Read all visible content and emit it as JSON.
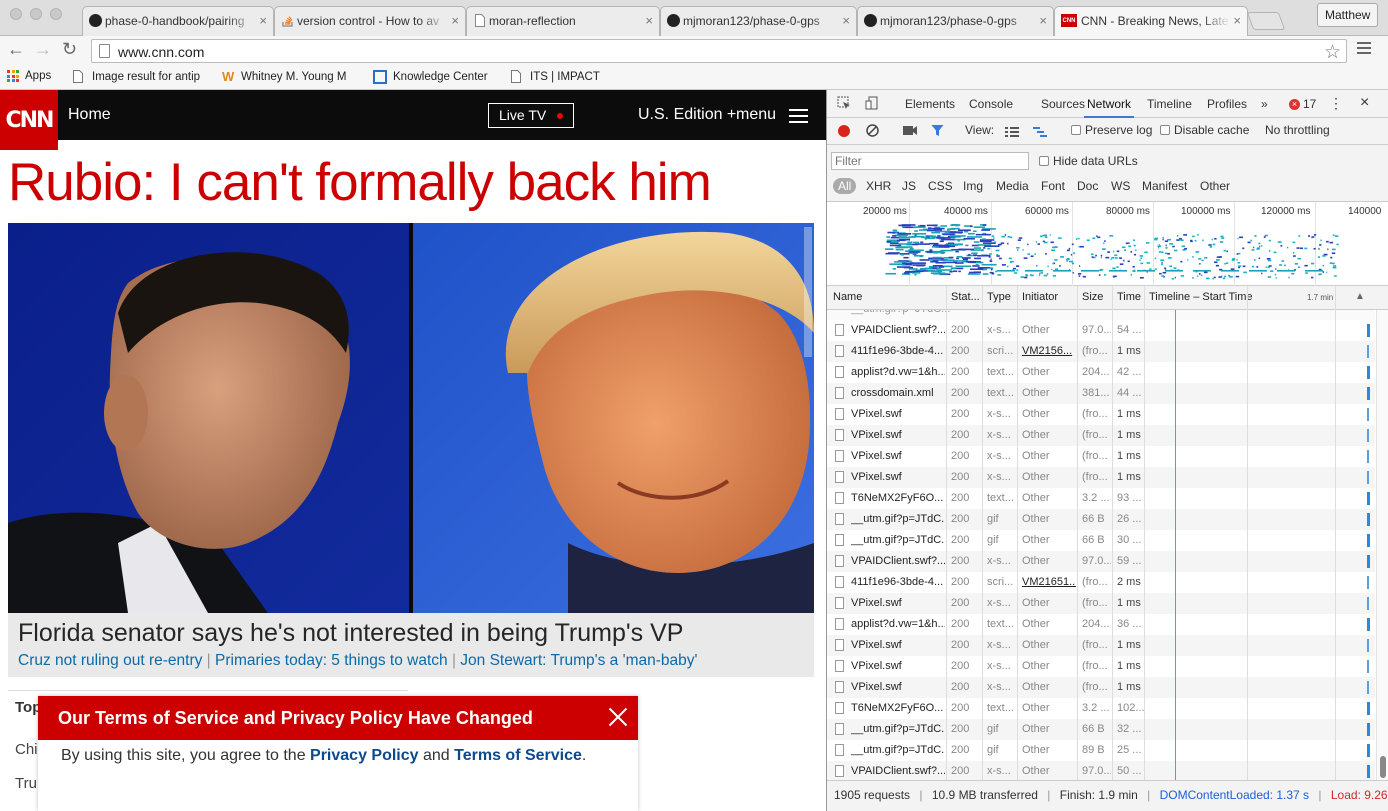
{
  "browser": {
    "tabs": [
      {
        "title": "phase-0-handbook/pairing",
        "icon": "github-icon"
      },
      {
        "title": "version control - How to av",
        "icon": "stackoverflow-icon"
      },
      {
        "title": "moran-reflection",
        "icon": "page-icon"
      },
      {
        "title": "mjmoran123/phase-0-gps",
        "icon": "github-icon"
      },
      {
        "title": "mjmoran123/phase-0-gps",
        "icon": "github-icon"
      },
      {
        "title": "CNN - Breaking News, Late",
        "icon": "cnn-icon"
      }
    ],
    "profile_name": "Matthew",
    "url": "www.cnn.com",
    "bookmarks": [
      "Apps",
      "Image result for antip",
      "Whitney M. Young M",
      "Knowledge Center",
      "ITS | IMPACT"
    ]
  },
  "cnn": {
    "logo_text": "CNN",
    "home_link": "Home",
    "live_tv": "Live TV",
    "edition": "U.S. Edition +",
    "menu": "menu",
    "headline": "Rubio: I can't formally back him",
    "subheadline": "Florida senator says he's not interested in being Trump's VP",
    "related": [
      "Cruz not ruling out re-entry",
      "Primaries today: 5 things to watch",
      "Jon Stewart: Trump's a 'man-baby'"
    ],
    "related_sep": "|",
    "top_section_label": "Top",
    "list_stubs": [
      "Chin",
      "Trum"
    ],
    "tos_title": "Our Terms of Service and Privacy Policy Have Changed",
    "tos_body_1": "By using this site, you agree to the ",
    "tos_privacy_link": "Privacy Policy",
    "tos_and": " and ",
    "tos_terms_link": "Terms of Service",
    "tos_period": "."
  },
  "devtools": {
    "tabs": [
      "Elements",
      "Console",
      "Sources",
      "Network",
      "Timeline",
      "Profiles"
    ],
    "active_tab": "Network",
    "more": "»",
    "error_count": "17",
    "view_label": "View:",
    "preserve_log": "Preserve log",
    "disable_cache": "Disable cache",
    "throttling": "No throttling",
    "filter_placeholder": "Filter",
    "hide_data_urls": "Hide data URLs",
    "type_filters": [
      "All",
      "XHR",
      "JS",
      "CSS",
      "Img",
      "Media",
      "Font",
      "Doc",
      "WS",
      "Manifest",
      "Other"
    ],
    "overview_ticks": [
      "20000 ms",
      "40000 ms",
      "60000 ms",
      "80000 ms",
      "100000 ms",
      "120000 ms",
      "140000"
    ],
    "columns": [
      "Name",
      "Stat...",
      "Type",
      "Initiator",
      "Size",
      "Time",
      "Timeline – Start Time"
    ],
    "timeline_scale": "1.7 min",
    "rows": [
      {
        "name": "VPAIDClient.swf?...",
        "status": "200",
        "type": "x-s...",
        "initiator": "Other",
        "size": "97.0...",
        "time": "54 ..."
      },
      {
        "name": "411f1e96-3bde-4...",
        "status": "200",
        "type": "scri...",
        "initiator": "VM2156...",
        "size": "(fro...",
        "time": "1 ms"
      },
      {
        "name": "applist?d.vw=1&h...",
        "status": "200",
        "type": "text...",
        "initiator": "Other",
        "size": "204...",
        "time": "42 ..."
      },
      {
        "name": "crossdomain.xml",
        "status": "200",
        "type": "text...",
        "initiator": "Other",
        "size": "381...",
        "time": "44 ..."
      },
      {
        "name": "VPixel.swf",
        "status": "200",
        "type": "x-s...",
        "initiator": "Other",
        "size": "(fro...",
        "time": "1 ms"
      },
      {
        "name": "VPixel.swf",
        "status": "200",
        "type": "x-s...",
        "initiator": "Other",
        "size": "(fro...",
        "time": "1 ms"
      },
      {
        "name": "VPixel.swf",
        "status": "200",
        "type": "x-s...",
        "initiator": "Other",
        "size": "(fro...",
        "time": "1 ms"
      },
      {
        "name": "VPixel.swf",
        "status": "200",
        "type": "x-s...",
        "initiator": "Other",
        "size": "(fro...",
        "time": "1 ms"
      },
      {
        "name": "T6NeMX2FyF6O...",
        "status": "200",
        "type": "text...",
        "initiator": "Other",
        "size": "3.2 ...",
        "time": "93 ..."
      },
      {
        "name": "__utm.gif?p=JTdC...",
        "status": "200",
        "type": "gif",
        "initiator": "Other",
        "size": "66 B",
        "time": "26 ..."
      },
      {
        "name": "__utm.gif?p=JTdC...",
        "status": "200",
        "type": "gif",
        "initiator": "Other",
        "size": "66 B",
        "time": "30 ..."
      },
      {
        "name": "VPAIDClient.swf?...",
        "status": "200",
        "type": "x-s...",
        "initiator": "Other",
        "size": "97.0...",
        "time": "59 ..."
      },
      {
        "name": "411f1e96-3bde-4...",
        "status": "200",
        "type": "scri...",
        "initiator": "VM21651...",
        "size": "(fro...",
        "time": "2 ms"
      },
      {
        "name": "VPixel.swf",
        "status": "200",
        "type": "x-s...",
        "initiator": "Other",
        "size": "(fro...",
        "time": "1 ms"
      },
      {
        "name": "applist?d.vw=1&h...",
        "status": "200",
        "type": "text...",
        "initiator": "Other",
        "size": "204...",
        "time": "36 ..."
      },
      {
        "name": "VPixel.swf",
        "status": "200",
        "type": "x-s...",
        "initiator": "Other",
        "size": "(fro...",
        "time": "1 ms"
      },
      {
        "name": "VPixel.swf",
        "status": "200",
        "type": "x-s...",
        "initiator": "Other",
        "size": "(fro...",
        "time": "1 ms"
      },
      {
        "name": "VPixel.swf",
        "status": "200",
        "type": "x-s...",
        "initiator": "Other",
        "size": "(fro...",
        "time": "1 ms"
      },
      {
        "name": "T6NeMX2FyF6O...",
        "status": "200",
        "type": "text...",
        "initiator": "Other",
        "size": "3.2 ...",
        "time": "102..."
      },
      {
        "name": "__utm.gif?p=JTdC...",
        "status": "200",
        "type": "gif",
        "initiator": "Other",
        "size": "66 B",
        "time": "32 ..."
      },
      {
        "name": "__utm.gif?p=JTdC...",
        "status": "200",
        "type": "gif",
        "initiator": "Other",
        "size": "89 B",
        "time": "25 ..."
      },
      {
        "name": "VPAIDClient.swf?...",
        "status": "200",
        "type": "x-s...",
        "initiator": "Other",
        "size": "97.0...",
        "time": "50 ..."
      }
    ],
    "status_bar": {
      "requests": "1905 requests",
      "transferred": "10.9 MB transferred",
      "finish": "Finish: 1.9 min",
      "dom_loaded": "DOMContentLoaded: 1.37 s",
      "load": "Load: 9.26 s",
      "sep": "|"
    }
  },
  "colors": {
    "cnn_red": "#cc0000",
    "link_blue": "#0c6aa8",
    "devtools_accent": "#3879d9"
  }
}
